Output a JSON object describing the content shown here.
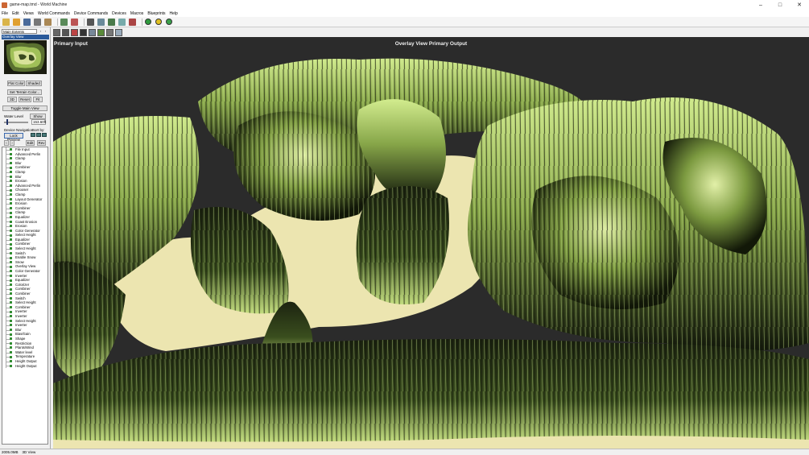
{
  "window": {
    "title": "game-map.tmd - World Machine"
  },
  "menu": [
    "File",
    "Edit",
    "Views",
    "World Commands",
    "Device Commands",
    "Devices",
    "Macros",
    "Blueprints",
    "Help"
  ],
  "toolbar_icons": [
    "new-file-icon",
    "open-file-icon",
    "save-icon",
    "export-icon",
    "import-icon",
    "render-icon",
    "render-extents-icon",
    "layout-view-icon",
    "settings-icon",
    "3d-view-icon",
    "explorer-icon",
    "green-ball-icon",
    "yellow-ball-icon",
    "green-globe-icon"
  ],
  "sidebar": {
    "extents": "Main Extents",
    "overlay_label": "Overlay View",
    "buttons": {
      "flat_color": "Flat Color",
      "shaded": "Shaded",
      "set_terrain_color": "Set Terrain Color...",
      "three_d": "3D",
      "reset": "Reset",
      "fit": "Fit",
      "toggle_main_view": "Toggle Main View",
      "show": "Show",
      "lock_preview": "Lock Preview",
      "edit": "Edit",
      "rev": "Rev"
    },
    "water_level_label": "Water Level",
    "water_level_value": "153.60ft",
    "device_navigation": "Device Navigation",
    "sort_by": "Sort by:",
    "devices": [
      "File Input",
      "Advanced Perlin",
      "Clamp",
      "Blur",
      "Combiner",
      "Clamp",
      "Blur",
      "Erosion",
      "Advanced Perlin",
      "Chooser",
      "Clamp",
      "Layout Generator",
      "Erosion",
      "Combiner",
      "Clamp",
      "Equalizer",
      "Coast Erosion",
      "Erosion",
      "Color Generator",
      "Select Height",
      "Equalizer",
      "Combiner",
      "Select Height",
      "Switch",
      "Enable Snow",
      "Snow",
      "Overlay View",
      "Color Generator",
      "Inverter",
      "Equalizer",
      "Colorizer",
      "Combiner",
      "Combiner",
      "Switch",
      "Select Height",
      "Combiner",
      "Inverter",
      "Inverter",
      "Select Height",
      "Inverter",
      "Blur",
      "Bias/Gain",
      "Shape",
      "Restriction",
      "Plants/Wind",
      "Water level",
      "Temperature",
      "Height Output",
      "Height Output"
    ]
  },
  "view_toolbar_icons": [
    "layout-icon",
    "device-icon",
    "picture-icon",
    "camera-icon",
    "window-icon",
    "terrain-icon",
    "lock-icon",
    "grid-icon"
  ],
  "viewport": {
    "left_label": "Primary Input",
    "center_label": "Overlay View Primary Output"
  },
  "status": [
    "2005.0MB",
    "3D View"
  ],
  "colors": {
    "accent": "#2a5a9a",
    "terrain_glow": "#c8e68a",
    "sand": "#ece5b0",
    "viewport_bg": "#2b2b2b"
  }
}
